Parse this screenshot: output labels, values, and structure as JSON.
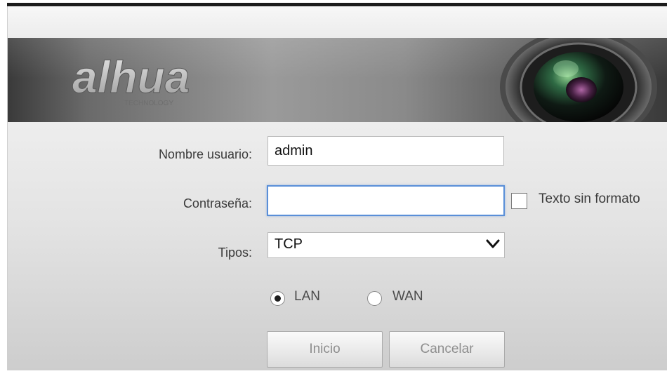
{
  "brand": {
    "logo_text": "alhua",
    "logo_subtext": "TECHNOLOGY"
  },
  "form": {
    "username": {
      "label": "Nombre usuario:",
      "value": "admin"
    },
    "password": {
      "label": "Contraseña:",
      "value": ""
    },
    "plain_text": {
      "label": "Texto sin formato",
      "checked": false
    },
    "type": {
      "label": "Tipos:",
      "selected": "TCP"
    },
    "network": {
      "options": [
        {
          "label": "LAN",
          "selected": true
        },
        {
          "label": "WAN",
          "selected": false
        }
      ]
    }
  },
  "buttons": {
    "login_label": "Inicio",
    "cancel_label": "Cancelar"
  },
  "colors": {
    "focus_border": "#5a8fd8",
    "banner_dark": "#3a3a3a",
    "panel_bg": "#e3e3e3"
  }
}
